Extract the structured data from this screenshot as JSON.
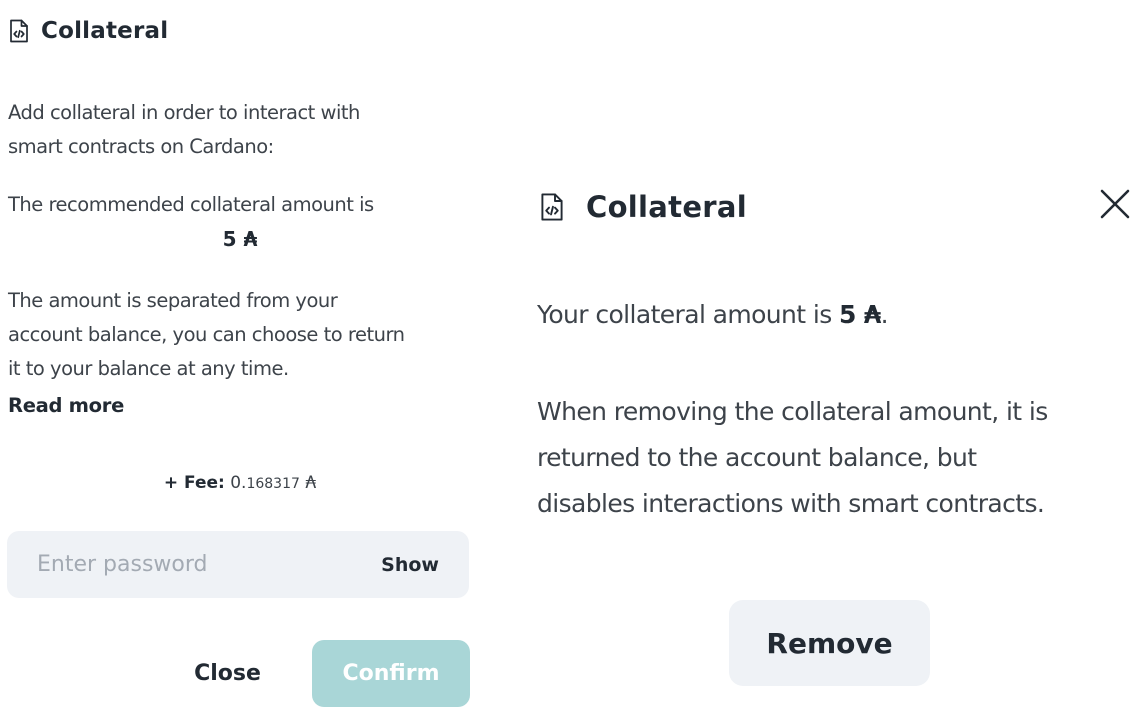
{
  "left_panel": {
    "title": "Collateral",
    "title_icon": "document-code-icon",
    "intro_line1": "Add collateral in order to interact with",
    "intro_line2": "smart contracts on Cardano:",
    "recommended_text": "The recommended collateral amount is",
    "recommended_amount": "5 ₳",
    "separated_line1": "The amount is separated from your",
    "separated_line2": "account balance, you can choose to return",
    "separated_line3": "it to your balance at any time.",
    "read_more": "Read more",
    "fee": {
      "label": "+ Fee:",
      "integer_part": "0.",
      "decimal_part": "168317",
      "unit": "₳"
    },
    "password": {
      "placeholder": "Enter password",
      "value": "",
      "show_label": "Show"
    },
    "close_label": "Close",
    "confirm_label": "Confirm"
  },
  "right_panel": {
    "title": "Collateral",
    "title_icon": "document-code-icon",
    "close_icon": "close-icon",
    "amount_prefix": "Your collateral amount is ",
    "amount_value": "5 ₳",
    "amount_suffix": ".",
    "removal_line1": "When removing the collateral amount, it is",
    "removal_line2": "returned to the account balance, but",
    "removal_line3": "disables interactions with smart contracts.",
    "remove_label": "Remove"
  },
  "colors": {
    "text_dark": "#222a33",
    "text_body": "#3d434a",
    "input_bg": "#eff2f6",
    "confirm_disabled_bg": "#a9d6d7"
  }
}
